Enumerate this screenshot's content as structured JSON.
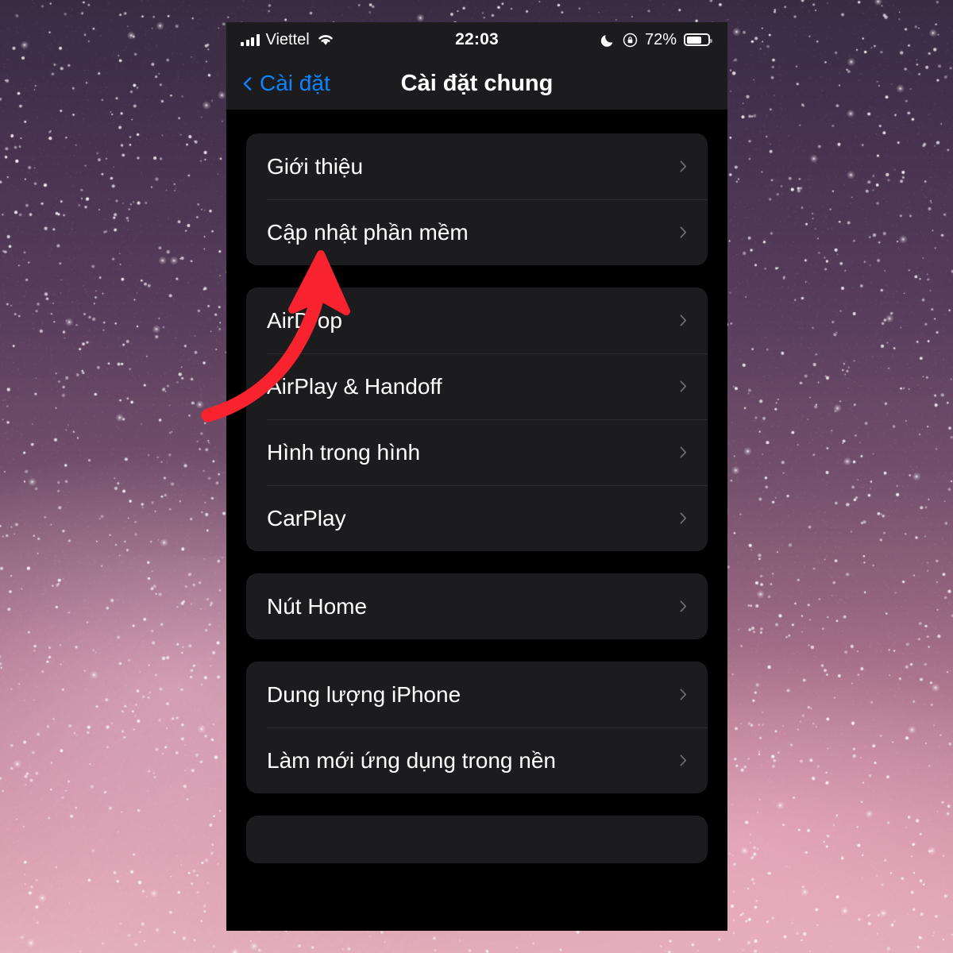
{
  "wallpaper": {
    "description": "starfield-galaxy",
    "top_color": "#3a2b43",
    "bottom_color": "#e2acb9"
  },
  "statusbar": {
    "signal_icon": "cellular-bars-icon",
    "carrier": "Viettel",
    "wifi_icon": "wifi-icon",
    "time": "22:03",
    "dnd_icon": "crescent-moon-icon",
    "rotation_lock_icon": "rotation-lock-icon",
    "battery_percent": "72%",
    "battery_icon": "battery-icon",
    "battery_level": 72
  },
  "navbar": {
    "back_icon": "chevron-left-icon",
    "back_label": "Cài đặt",
    "title": "Cài đặt chung",
    "accent_color": "#0a84ff"
  },
  "groups": [
    {
      "name": "about-group",
      "rows": [
        {
          "label": "Giới thiệu",
          "chevron": "chevron-right-icon"
        },
        {
          "label": "Cập nhật phần mềm",
          "chevron": "chevron-right-icon"
        }
      ]
    },
    {
      "name": "sharing-group",
      "rows": [
        {
          "label": "AirDrop",
          "chevron": "chevron-right-icon"
        },
        {
          "label": "AirPlay & Handoff",
          "chevron": "chevron-right-icon"
        },
        {
          "label": "Hình trong hình",
          "chevron": "chevron-right-icon"
        },
        {
          "label": "CarPlay",
          "chevron": "chevron-right-icon"
        }
      ]
    },
    {
      "name": "home-button-group",
      "rows": [
        {
          "label": "Nút Home",
          "chevron": "chevron-right-icon"
        }
      ]
    },
    {
      "name": "storage-group",
      "rows": [
        {
          "label": "Dung lượng iPhone",
          "chevron": "chevron-right-icon"
        },
        {
          "label": "Làm mới ứng dụng trong nền",
          "chevron": "chevron-right-icon"
        }
      ]
    },
    {
      "name": "partial-group",
      "rows": []
    }
  ],
  "annotation": {
    "type": "curved-arrow",
    "color": "#f8232f",
    "points_to": "Cập nhật phần mềm"
  }
}
